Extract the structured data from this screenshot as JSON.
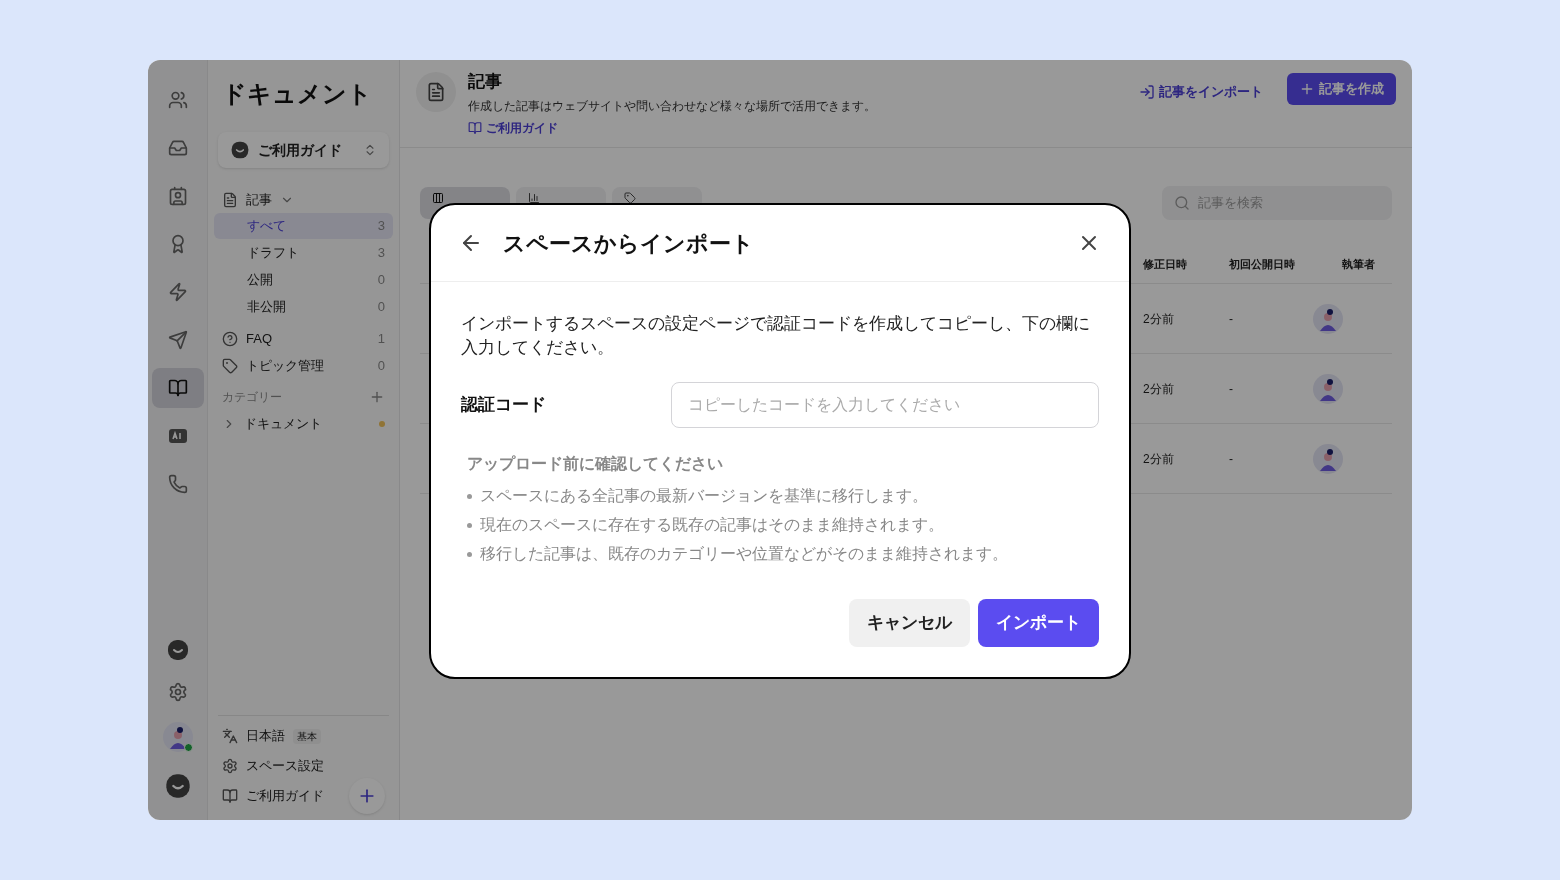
{
  "rail": {
    "items": [
      {
        "kind": "users",
        "selected": false
      },
      {
        "kind": "inbox",
        "selected": false
      },
      {
        "kind": "contact",
        "selected": false
      },
      {
        "kind": "badge",
        "selected": false
      },
      {
        "kind": "bolt",
        "selected": false
      },
      {
        "kind": "send",
        "selected": false
      },
      {
        "kind": "book",
        "selected": true
      },
      {
        "kind": "ai",
        "selected": false
      },
      {
        "kind": "phone",
        "selected": false
      }
    ],
    "bottom": [
      {
        "kind": "chat"
      },
      {
        "kind": "settings"
      },
      {
        "kind": "avatar"
      },
      {
        "kind": "logo"
      }
    ]
  },
  "sidebar": {
    "title": "ドキュメント",
    "space": "ご利用ガイド",
    "articles": {
      "label": "記事",
      "expanded": true,
      "items": [
        {
          "label": "すべて",
          "count": "3",
          "selected": true
        },
        {
          "label": "ドラフト",
          "count": "3",
          "selected": false
        },
        {
          "label": "公開",
          "count": "0",
          "selected": false
        },
        {
          "label": "非公開",
          "count": "0",
          "selected": false
        }
      ]
    },
    "others": [
      {
        "kind": "faq",
        "label": "FAQ",
        "count": "1"
      },
      {
        "kind": "tag",
        "label": "トピック管理",
        "count": "0"
      }
    ],
    "categories_label": "カテゴリー",
    "categories": [
      {
        "label": "ドキュメント"
      }
    ],
    "footer": [
      {
        "kind": "translate",
        "label": "日本語",
        "badge": "基本"
      },
      {
        "kind": "settings",
        "label": "スペース設定"
      },
      {
        "kind": "book",
        "label": "ご利用ガイド"
      }
    ]
  },
  "header": {
    "title": "記事",
    "description": "作成した記事はウェブサイトや問い合わせなど様々な場所で活用できます。",
    "guide_link": "ご利用ガイド",
    "import_button": "記事をインポート",
    "create_button": "記事を作成"
  },
  "tabs": [
    {
      "selected": true
    },
    {
      "selected": false
    },
    {
      "selected": false
    }
  ],
  "search": {
    "placeholder": "記事を検索"
  },
  "table": {
    "columns": [
      "修正日時",
      "初回公開日時",
      "執筆者"
    ],
    "rows": [
      {
        "modified": "2分前",
        "published": "-"
      },
      {
        "modified": "2分前",
        "published": "-"
      },
      {
        "modified": "2分前",
        "published": "-"
      }
    ]
  },
  "dialog": {
    "title": "スペースからインポート",
    "instruction": "インポートするスペースの設定ページで認証コードを作成してコピーし、下の欄に入力してください。",
    "field_label": "認証コード",
    "field_placeholder": "コピーしたコードを入力してください",
    "notice_title": "アップロード前に確認してください",
    "notices": [
      "スペースにある全記事の最新バージョンを基準に移行します。",
      "現在のスペースに存在する既存の記事はそのまま維持されます。",
      "移行した記事は、既存のカテゴリーや位置などがそのまま維持されます。"
    ],
    "cancel": "キャンセル",
    "confirm": "インポート"
  }
}
